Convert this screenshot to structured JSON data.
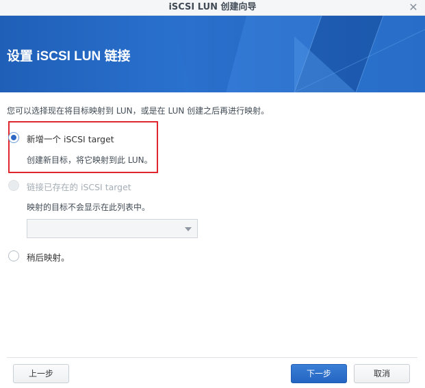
{
  "window": {
    "title": "iSCSI LUN 创建向导",
    "close_glyph": "✕"
  },
  "banner": {
    "title": "设置 iSCSI LUN 链接"
  },
  "intro": "您可以选择现在将目标映射到 LUN，或是在 LUN 创建之后再进行映射。",
  "options": [
    {
      "label": "新增一个 iSCSI target",
      "description": "创建新目标，将它映射到此 LUN。",
      "selected": true,
      "disabled": false
    },
    {
      "label": "链接已存在的 iSCSI target",
      "description": "映射的目标不会显示在此列表中。",
      "selected": false,
      "disabled": true
    },
    {
      "label": "稍后映射。",
      "selected": false,
      "disabled": false
    }
  ],
  "target_select": {
    "value": ""
  },
  "buttons": {
    "prev": "上一步",
    "next": "下一步",
    "cancel": "取消"
  },
  "colors": {
    "banner": "#2a72cf",
    "primary": "#2365c1",
    "highlight": "#e0262c"
  }
}
